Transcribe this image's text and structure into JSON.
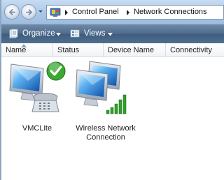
{
  "address_bar": {
    "breadcrumbs": [
      "Control Panel",
      "Network Connections"
    ]
  },
  "toolbar": {
    "organize_label": "Organize",
    "views_label": "Views"
  },
  "columns": [
    "Name",
    "Status",
    "Device Name",
    "Connectivity"
  ],
  "connections": [
    {
      "label": "VMCLite",
      "overlay": "check-icon"
    },
    {
      "label": "Wireless Network\nConnection",
      "overlay": "signal-bars-icon"
    }
  ],
  "colors": {
    "toolbar": "#4f6c8d",
    "check_green": "#3aa92f",
    "signal_green": "#2fa02a"
  }
}
